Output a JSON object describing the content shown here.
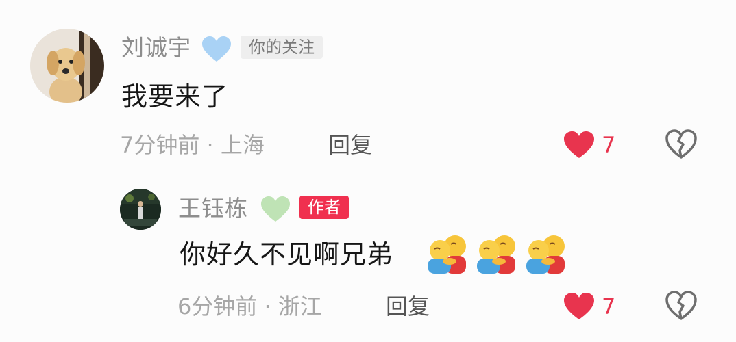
{
  "comments": [
    {
      "user": "刘诚宇",
      "name_heart_color": "#a9d2f5",
      "tag": "你的关注",
      "text": "我要来了",
      "meta": "7分钟前 · 上海",
      "reply": "回复",
      "likes": "7"
    },
    {
      "user": "王钰栋",
      "name_heart_color": "#bfe3b5",
      "tag": "作者",
      "text": "你好久不见啊兄弟",
      "emoji": "people-hugging",
      "emoji_count": 3,
      "meta": "6分钟前 · 浙江",
      "reply": "回复",
      "likes": "7"
    }
  ],
  "colors": {
    "like": "#e8344e",
    "author_tag": "#f0304f"
  }
}
